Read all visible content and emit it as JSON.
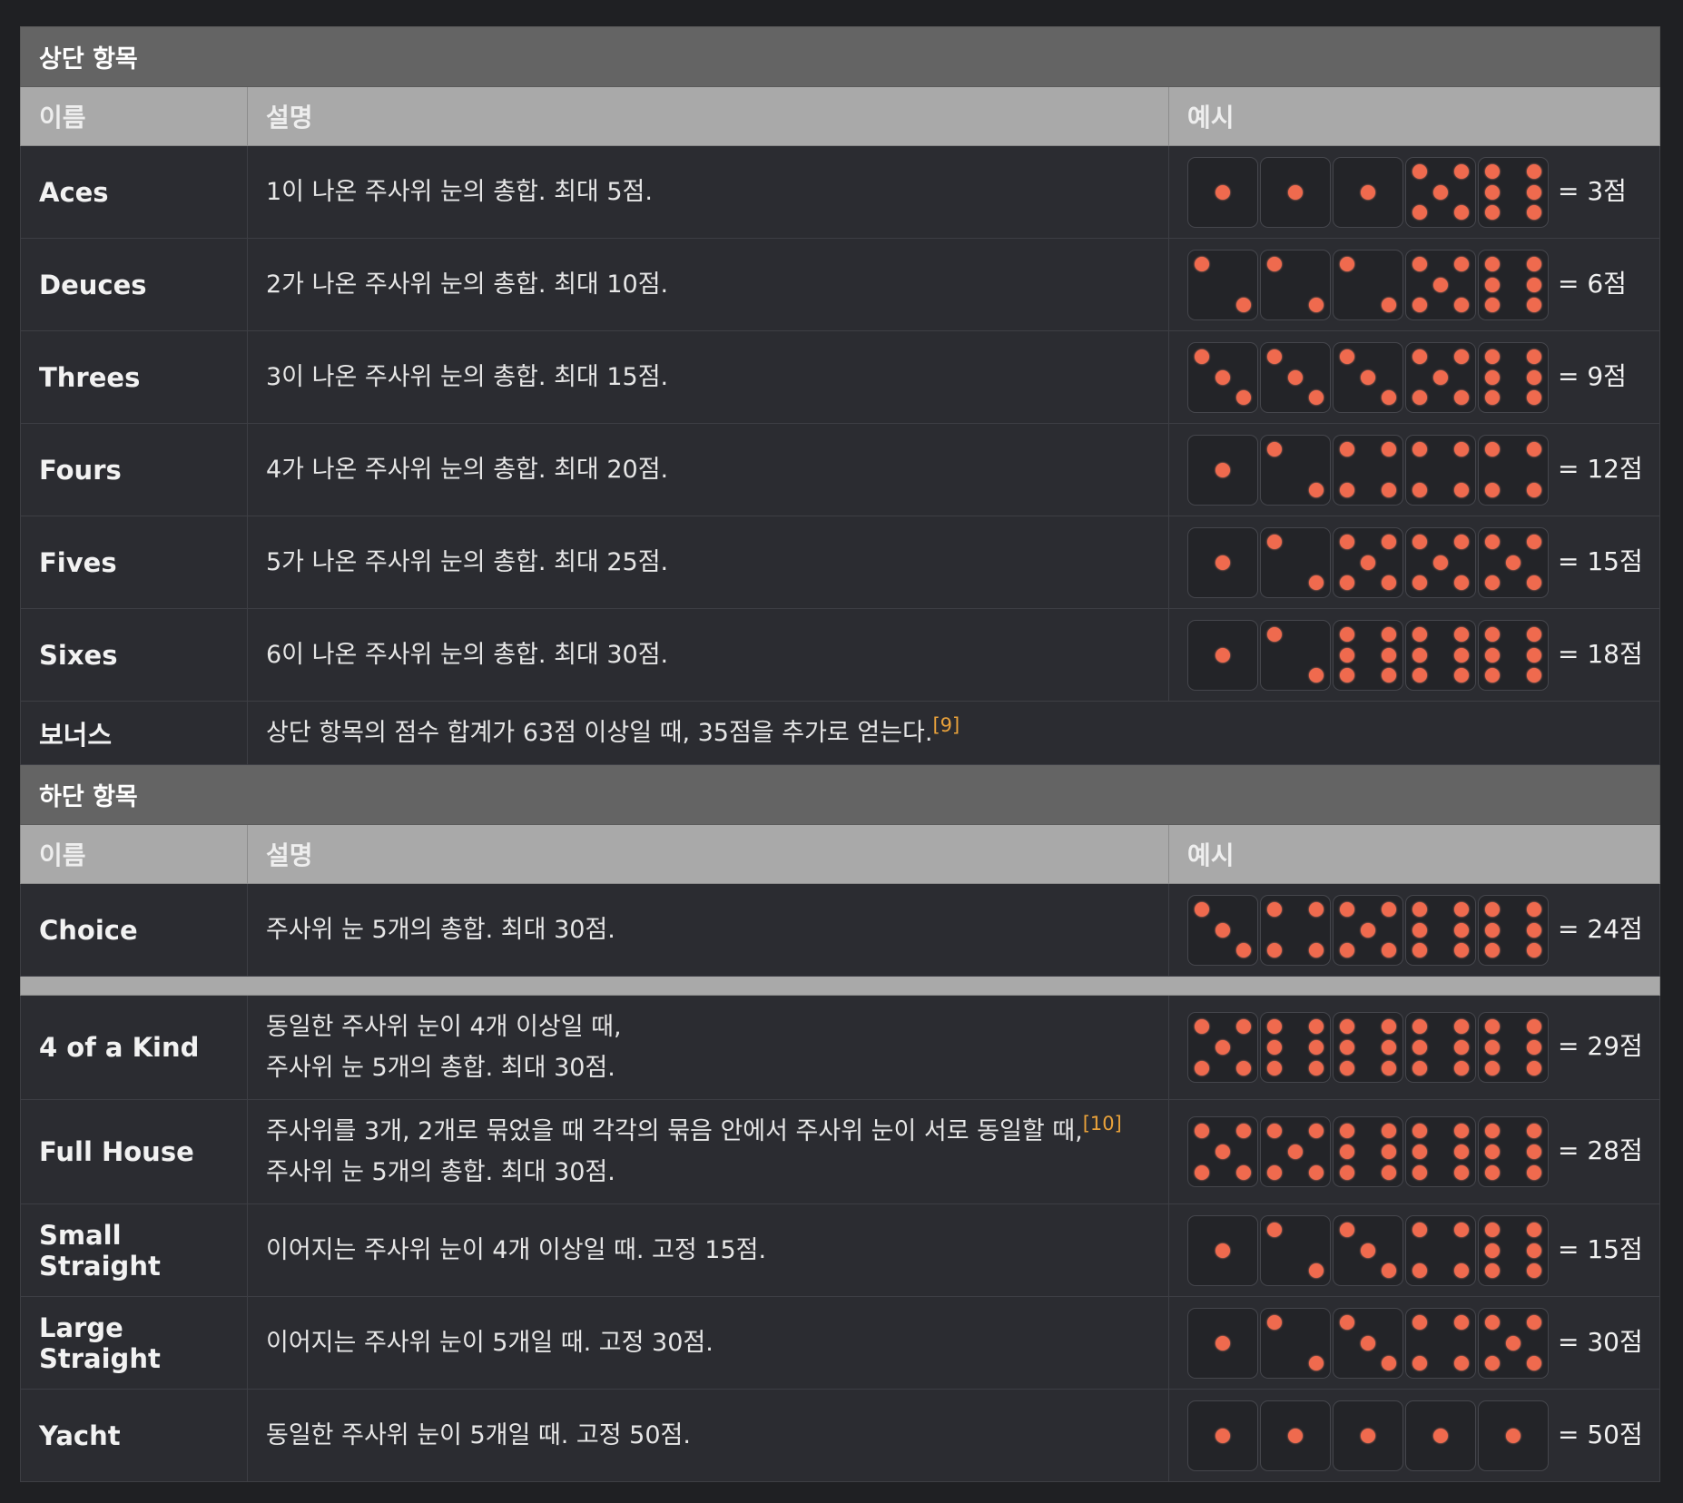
{
  "upper": {
    "title": "상단 항목",
    "headers": {
      "name": "이름",
      "desc": "설명",
      "example": "예시"
    },
    "rows": [
      {
        "name": "Aces",
        "desc": [
          "1이 나온 주사위 눈의 총합. 최대 5점."
        ],
        "dice": [
          1,
          1,
          1,
          5,
          6
        ],
        "score": "= 3점"
      },
      {
        "name": "Deuces",
        "desc": [
          "2가 나온 주사위 눈의 총합. 최대 10점."
        ],
        "dice": [
          2,
          2,
          2,
          5,
          6
        ],
        "score": "= 6점"
      },
      {
        "name": "Threes",
        "desc": [
          "3이 나온 주사위 눈의 총합. 최대 15점."
        ],
        "dice": [
          3,
          3,
          3,
          5,
          6
        ],
        "score": "= 9점"
      },
      {
        "name": "Fours",
        "desc": [
          "4가 나온 주사위 눈의 총합. 최대 20점."
        ],
        "dice": [
          1,
          2,
          4,
          4,
          4
        ],
        "score": "= 12점"
      },
      {
        "name": "Fives",
        "desc": [
          "5가 나온 주사위 눈의 총합. 최대 25점."
        ],
        "dice": [
          1,
          2,
          5,
          5,
          5
        ],
        "score": "= 15점"
      },
      {
        "name": "Sixes",
        "desc": [
          "6이 나온 주사위 눈의 총합. 최대 30점."
        ],
        "dice": [
          1,
          2,
          6,
          6,
          6
        ],
        "score": "= 18점"
      }
    ],
    "bonus": {
      "name": "보너스",
      "desc": "상단 항목의 점수 합계가 63점 이상일 때, 35점을 추가로 얻는다.",
      "note": "[9]"
    }
  },
  "lower": {
    "title": "하단 항목",
    "headers": {
      "name": "이름",
      "desc": "설명",
      "example": "예시"
    },
    "choice": {
      "name": "Choice",
      "desc": [
        "주사위 눈 5개의 총합. 최대 30점."
      ],
      "dice": [
        3,
        4,
        5,
        6,
        6
      ],
      "score": "= 24점"
    },
    "rows": [
      {
        "name": "4 of a Kind",
        "desc": [
          "동일한 주사위 눈이 4개 이상일 때,",
          "주사위 눈 5개의 총합. 최대 30점."
        ],
        "dice": [
          5,
          6,
          6,
          6,
          6
        ],
        "score": "= 29점"
      },
      {
        "name": "Full House",
        "desc": [
          "주사위를 3개, 2개로 묶었을 때 각각의 묶음 안에서 주사위 눈이 서로 동일할 때,",
          "주사위 눈 5개의 총합. 최대 30점."
        ],
        "note": "[10]",
        "dice": [
          5,
          5,
          6,
          6,
          6
        ],
        "score": "= 28점"
      },
      {
        "name": "Small Straight",
        "desc": [
          "이어지는 주사위 눈이 4개 이상일 때. 고정 15점."
        ],
        "dice": [
          1,
          2,
          3,
          4,
          6
        ],
        "score": "= 15점"
      },
      {
        "name": "Large Straight",
        "desc": [
          "이어지는 주사위 눈이 5개일 때. 고정 30점."
        ],
        "dice": [
          1,
          2,
          3,
          4,
          5
        ],
        "score": "= 30점"
      },
      {
        "name": "Yacht",
        "desc": [
          "동일한 주사위 눈이 5개일 때. 고정 50점."
        ],
        "dice": [
          1,
          1,
          1,
          1,
          1
        ],
        "score": "= 50점"
      }
    ]
  },
  "colors": {
    "pip": "#ef6a4e",
    "section_bg": "#646464",
    "header_bg": "#a9a9a9",
    "table_bg": "#2b2c31",
    "footnote": "#e9a23b"
  }
}
